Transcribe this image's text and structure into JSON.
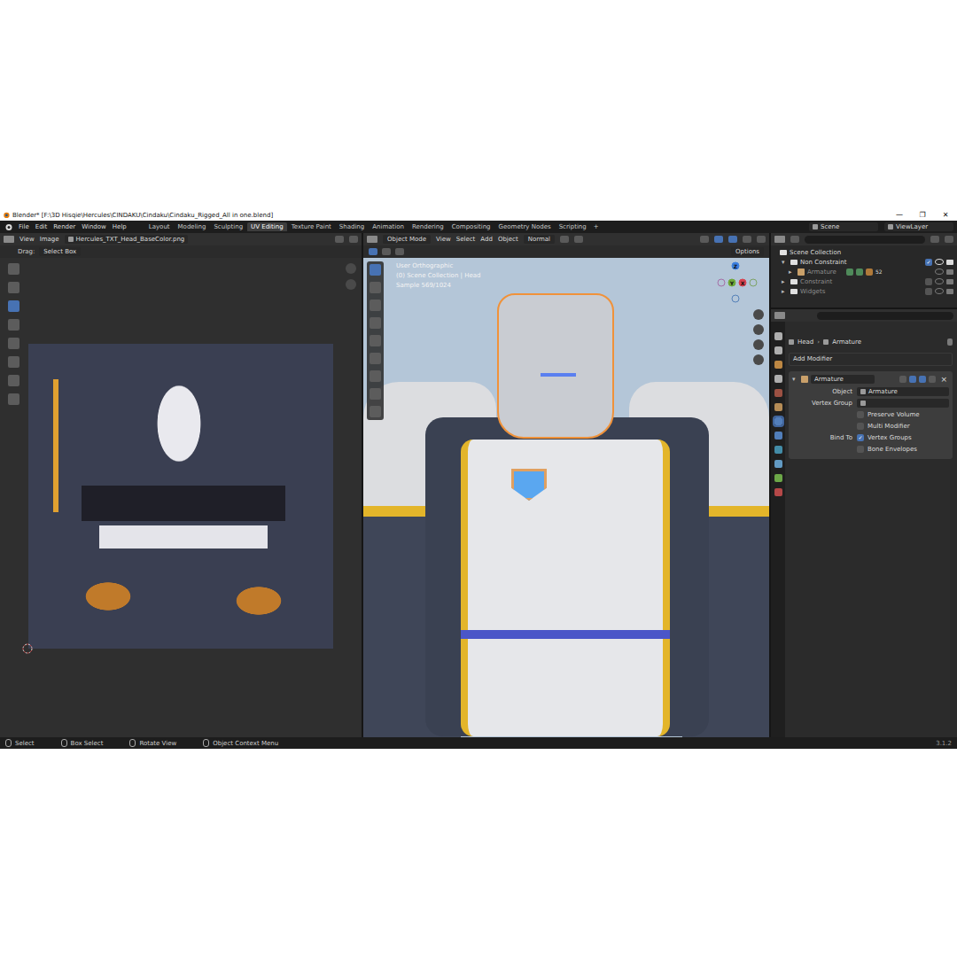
{
  "window": {
    "title": "Blender* [F:\\3D Hisqie\\Hercules\\CINDAKU\\Cindaku\\Cindaku_Rigged_All in one.blend]",
    "controls": [
      "—",
      "❐",
      "✕"
    ]
  },
  "menu": [
    "File",
    "Edit",
    "Render",
    "Window",
    "Help"
  ],
  "workspaces": [
    {
      "label": "Layout",
      "selected": false
    },
    {
      "label": "Modeling",
      "selected": false
    },
    {
      "label": "Sculpting",
      "selected": false
    },
    {
      "label": "UV Editing",
      "selected": true
    },
    {
      "label": "Texture Paint",
      "selected": false
    },
    {
      "label": "Shading",
      "selected": false
    },
    {
      "label": "Animation",
      "selected": false
    },
    {
      "label": "Rendering",
      "selected": false
    },
    {
      "label": "Compositing",
      "selected": false
    },
    {
      "label": "Geometry Nodes",
      "selected": false
    },
    {
      "label": "Scripting",
      "selected": false
    }
  ],
  "add_workspace": "+",
  "scene": "Scene",
  "view_layer": "ViewLayer",
  "uv_editor": {
    "menus": [
      "View",
      "Image"
    ],
    "image_name": "Hercules_TXT_Head_BaseColor.png",
    "drag_label": "Drag:",
    "drag_value": "Select Box"
  },
  "viewport": {
    "mode": "Object Mode",
    "menus": [
      "View",
      "Select",
      "Add",
      "Object"
    ],
    "orientation": "Normal",
    "options": "Options",
    "overlay": [
      "User Orthographic",
      "(0) Scene Collection | Head",
      "Sample 569/1024"
    ],
    "axes": [
      {
        "label": "Z",
        "positive": true,
        "color": "#3b7fe0"
      },
      {
        "label": "",
        "positive": false,
        "color": "#a05a9a"
      },
      {
        "label": "Y",
        "positive": true,
        "color": "#6fa83a"
      },
      {
        "label": "X",
        "positive": true,
        "color": "#d8414e"
      },
      {
        "label": "",
        "positive": false,
        "color": "#6f9a4a"
      },
      {
        "label": "",
        "positive": false,
        "color": "#3f6fb0"
      }
    ]
  },
  "outliner": {
    "root": "Scene Collection",
    "items": [
      {
        "label": "Non Constraint",
        "kind": "collection",
        "depth": 1,
        "expanded": true,
        "included": true,
        "greyed": false,
        "badge": ""
      },
      {
        "label": "Armature",
        "kind": "object",
        "depth": 2,
        "expanded": false,
        "included": true,
        "greyed": true,
        "badge": "52"
      },
      {
        "label": "Constraint",
        "kind": "collection",
        "depth": 1,
        "expanded": false,
        "included": false,
        "greyed": true,
        "badge": ""
      },
      {
        "label": "Widgets",
        "kind": "collection",
        "depth": 1,
        "expanded": false,
        "included": false,
        "greyed": true,
        "badge": ""
      }
    ]
  },
  "properties": {
    "breadcrumb": [
      "Head",
      "Armature"
    ],
    "add_modifier": "Add Modifier",
    "modifier": {
      "name": "Armature",
      "expanded": true,
      "fields": [
        {
          "label": "Object",
          "value": "Armature"
        },
        {
          "label": "Vertex Group",
          "value": ""
        }
      ],
      "options": [
        {
          "group": "",
          "label": "Preserve Volume",
          "checked": false
        },
        {
          "group": "",
          "label": "Multi Modifier",
          "checked": false
        },
        {
          "group": "Bind To",
          "label": "Vertex Groups",
          "checked": true
        },
        {
          "group": "",
          "label": "Bone Envelopes",
          "checked": false
        }
      ]
    }
  },
  "status_bar": {
    "items": [
      "Select",
      "Box Select",
      "Rotate View",
      "Object Context Menu"
    ],
    "version": "3.1.2"
  }
}
